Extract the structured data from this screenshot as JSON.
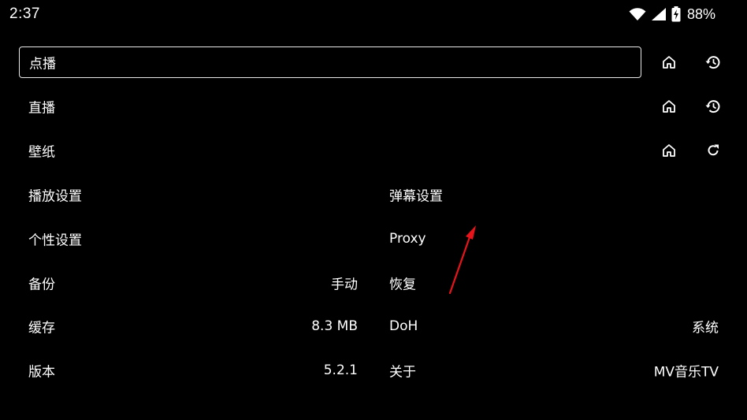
{
  "status": {
    "time": "2:37",
    "battery": "88%",
    "icons": [
      "wifi-icon",
      "signal-icon",
      "battery-charging-icon"
    ]
  },
  "rows": {
    "vod": {
      "label": "点播",
      "focused": true,
      "icons": [
        "home-icon",
        "history-icon"
      ]
    },
    "live": {
      "label": "直播",
      "icons": [
        "home-icon",
        "history-icon"
      ]
    },
    "wallpaper": {
      "label": "壁纸",
      "icons": [
        "home-icon",
        "refresh-icon"
      ]
    }
  },
  "settings": {
    "playback": {
      "label": "播放设置",
      "value": ""
    },
    "danmaku": {
      "label": "弹幕设置",
      "value": ""
    },
    "personal": {
      "label": "个性设置",
      "value": ""
    },
    "proxy": {
      "label": "Proxy",
      "value": ""
    },
    "backup": {
      "label": "备份",
      "value": "手动"
    },
    "restore": {
      "label": "恢复",
      "value": ""
    },
    "cache": {
      "label": "缓存",
      "value": "8.3 MB"
    },
    "doh": {
      "label": "DoH",
      "value": "系统"
    },
    "version": {
      "label": "版本",
      "value": "5.2.1"
    },
    "about": {
      "label": "关于",
      "value": "MV音乐TV"
    }
  },
  "colors": {
    "background": "#000000",
    "text": "#ffffff",
    "focus_border": "#e8e8e8",
    "annotation_arrow": "#e8141b"
  }
}
